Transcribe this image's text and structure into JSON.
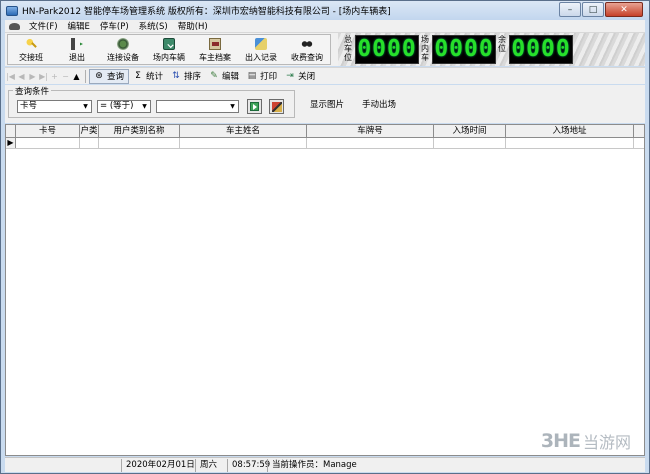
{
  "window": {
    "title": "HN-Park2012 智能停车场管理系统 版权所有：深圳市宏纳智能科技有限公司 - [场内车辆表]",
    "minimize": "–",
    "maximize": "□",
    "close": "✕"
  },
  "menu": [
    "文件(F)",
    "编辑E",
    "停车(P)",
    "系统(S)",
    "帮助(H)"
  ],
  "toolbar": {
    "buttons": [
      {
        "label": "交接班",
        "icon": "key-icon"
      },
      {
        "label": "退出",
        "icon": "exit-icon"
      },
      {
        "label": "连接设备",
        "icon": "connect-device-icon"
      },
      {
        "label": "场内车辆",
        "icon": "in-lot-vehicles-icon"
      },
      {
        "label": "车主档案",
        "icon": "owner-records-icon"
      },
      {
        "label": "出入记录",
        "icon": "entry-exit-log-icon"
      },
      {
        "label": "收费查询",
        "icon": "fee-query-icon"
      }
    ]
  },
  "led_panel": {
    "total_label": "总车位",
    "total_value": "0000",
    "inside_label": "场内车",
    "inside_value": "0000",
    "remaining_label": "余位",
    "remaining_value": "0000",
    "digit_color": "#27e02a"
  },
  "toolbar2": {
    "nav": [
      "|◀",
      "◀",
      "▶",
      "▶|",
      "+",
      "−",
      "▲"
    ],
    "buttons": [
      {
        "label": "查询",
        "icon": "binoculars-icon",
        "pressed": true
      },
      {
        "label": "统计",
        "icon": "sigma-icon"
      },
      {
        "label": "排序",
        "icon": "sort-icon"
      },
      {
        "label": "编辑",
        "icon": "edit-icon"
      },
      {
        "label": "打印",
        "icon": "printer-icon"
      },
      {
        "label": "关闭",
        "icon": "close-door-icon"
      }
    ]
  },
  "query": {
    "legend": "查询条件",
    "field": "卡号",
    "operator": "= (等于)",
    "value": "",
    "show_image": "显示图片",
    "manual_exit": "手动出场"
  },
  "grid": {
    "columns": [
      "卡号",
      "户类",
      "用户类别名称",
      "车主姓名",
      "车牌号",
      "入场时间",
      "入场地址"
    ],
    "row_marker": "▶"
  },
  "status": {
    "date": "2020年02月01日",
    "weekday": "周六",
    "time": "08:57:59",
    "operator": "当前操作员：Manage"
  },
  "watermark": {
    "logo": "3HE",
    "text": "当游网"
  }
}
